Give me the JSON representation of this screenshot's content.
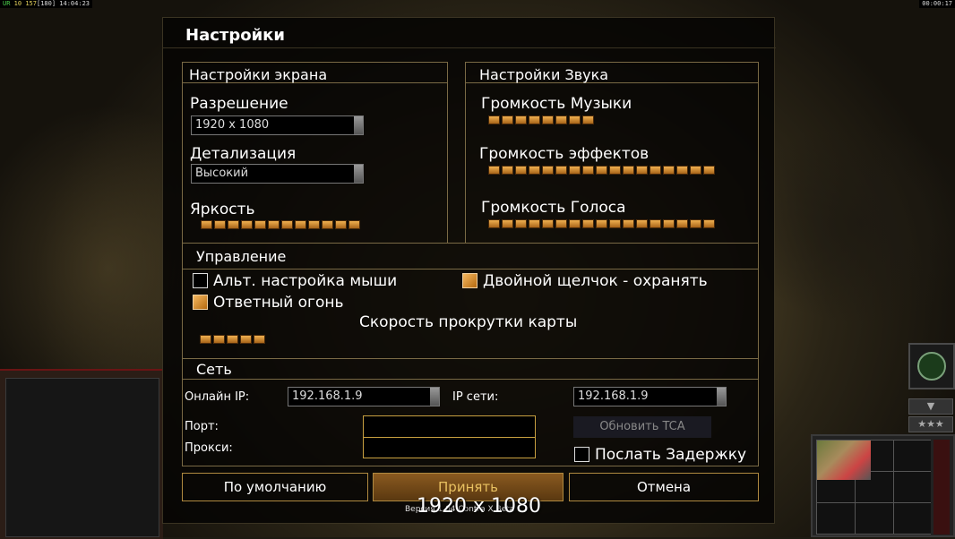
{
  "hud": {
    "stat_a": "UR",
    "stat_b": "10",
    "stat_c": "157",
    "stat_d": "180",
    "clock": "14:04:23",
    "timer": "00:00:17"
  },
  "dialog": {
    "title": "Настройки",
    "screen": {
      "section": "Настройки экрана",
      "resolution_label": "Разрешение",
      "resolution_value": "1920 x 1080",
      "detail_label": "Детализация",
      "detail_value": "Высокий",
      "brightness_label": "Яркость",
      "brightness_segments": 12
    },
    "sound": {
      "section": "Настройки Звука",
      "music_label": "Громкость Музыки",
      "music_segments": 8,
      "effects_label": "Громкость эффектов",
      "effects_segments": 17,
      "voice_label": "Громкость Голоса",
      "voice_segments": 17
    },
    "controls": {
      "section": "Управление",
      "alt_mouse_label": "Альт. настройка мыши",
      "alt_mouse_checked": false,
      "double_click_label": "Двойной щелчок - охранять",
      "double_click_checked": true,
      "return_fire_label": "Ответный огонь",
      "return_fire_checked": true,
      "scroll_label": "Скорость прокрутки карты",
      "scroll_segments": 5
    },
    "network": {
      "section": "Сеть",
      "online_ip_label": "Онлайн IP:",
      "online_ip_value": "192.168.1.9",
      "lan_ip_label": "IP сети:",
      "lan_ip_value": "192.168.1.9",
      "port_label": "Порт:",
      "proxy_label": "Прокси:",
      "update_tca_label": "Обновить TCA",
      "send_delay_label": "Послать Задержку",
      "send_delay_checked": false
    },
    "buttons": {
      "defaults": "По умолчанию",
      "accept": "Принять",
      "cancel": "Отмена"
    },
    "version_text": "Версия 1.04 Contra X Beta",
    "resolution_overlay": "1920 x 1080"
  },
  "colors": {
    "accent": "#c8a040",
    "segment": "#e09a3a"
  }
}
